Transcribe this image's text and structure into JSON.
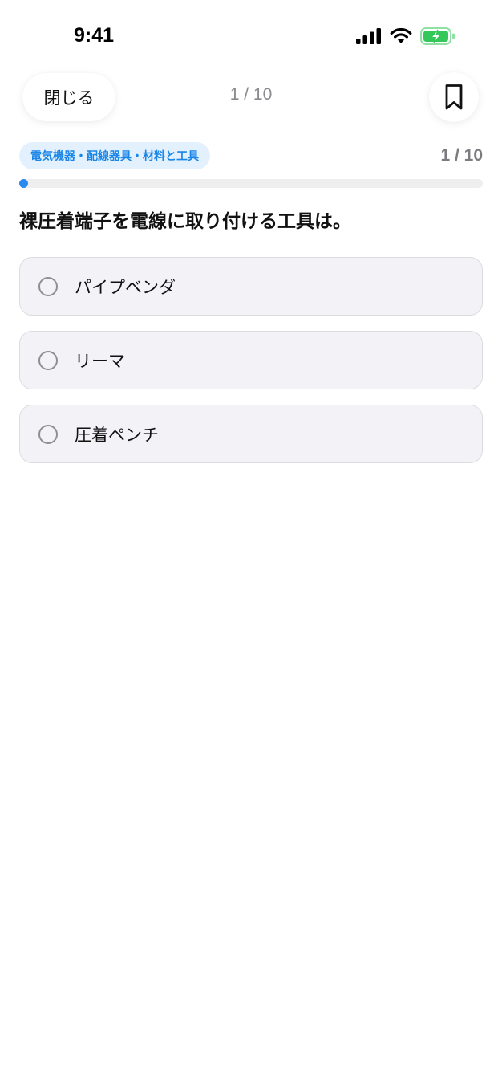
{
  "status_bar": {
    "time": "9:41",
    "icons": [
      "signal-icon",
      "wifi-icon",
      "battery-charging-icon"
    ],
    "battery_color": "#34c759"
  },
  "header": {
    "close_label": "閉じる",
    "progress_text": "1 / 10",
    "bookmark_icon": "bookmark-icon"
  },
  "quiz": {
    "category": "電気機器・配線器具・材料と工具",
    "counter": "1 / 10",
    "progress_fraction": 0.1,
    "question": "裸圧着端子を電線に取り付ける工具は。",
    "choices": [
      {
        "label": "パイプベンダ"
      },
      {
        "label": "リーマ"
      },
      {
        "label": "圧着ペンチ"
      }
    ]
  },
  "colors": {
    "accent": "#2a8af0",
    "badge_bg": "#e3f1fe",
    "choice_bg": "#f2f2f7"
  }
}
